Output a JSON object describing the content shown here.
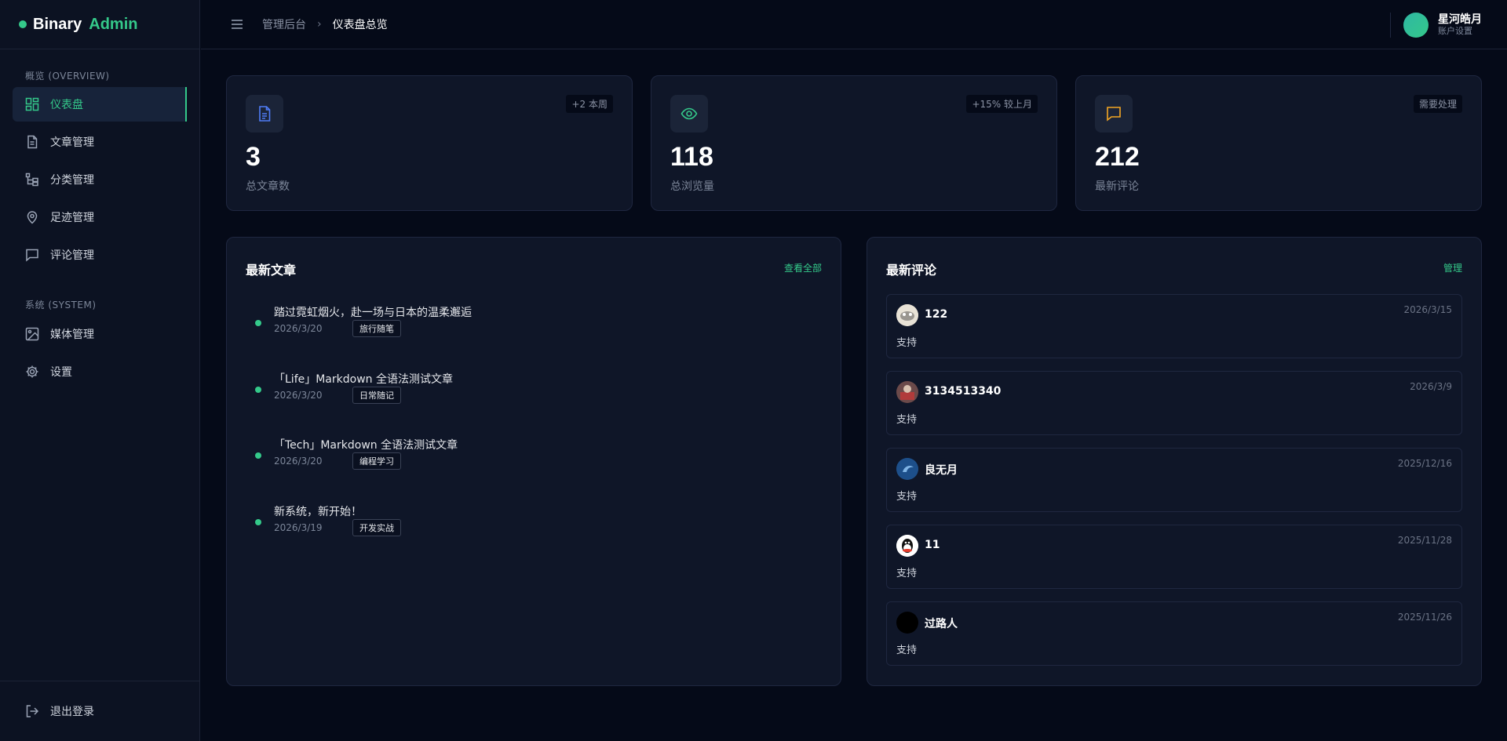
{
  "brand": {
    "name": "Binary",
    "accent": "Admin"
  },
  "sidebar": {
    "overview_label": "概览 (OVERVIEW)",
    "system_label": "系统 (SYSTEM)",
    "items": [
      {
        "label": "仪表盘",
        "icon": "dashboard-icon",
        "active": true
      },
      {
        "label": "文章管理",
        "icon": "document-icon"
      },
      {
        "label": "分类管理",
        "icon": "category-tree-icon"
      },
      {
        "label": "足迹管理",
        "icon": "map-pin-icon"
      },
      {
        "label": "评论管理",
        "icon": "message-icon"
      },
      {
        "label": "媒体管理",
        "icon": "image-icon"
      },
      {
        "label": "设置",
        "icon": "gear-icon"
      }
    ],
    "logout_label": "退出登录"
  },
  "header": {
    "breadcrumb_parent": "管理后台",
    "breadcrumb_current": "仪表盘总览",
    "user_name": "星河皓月",
    "user_sub": "账户设置"
  },
  "stats": [
    {
      "value": "3",
      "label": "总文章数",
      "badge": "+2 本周",
      "icon": "document-icon",
      "color": "#4f7cf5"
    },
    {
      "value": "118",
      "label": "总浏览量",
      "badge": "+15% 较上月",
      "icon": "eye-icon",
      "color": "#34c98a"
    },
    {
      "value": "212",
      "label": "最新评论",
      "badge": "需要处理",
      "icon": "message-icon",
      "color": "#f5a623"
    }
  ],
  "articles_panel": {
    "title": "最新文章",
    "link": "查看全部",
    "items": [
      {
        "title": "踏过霓虹烟火，赴一场与日本的温柔邂逅",
        "date": "2026/3/20",
        "tag": "旅行随笔"
      },
      {
        "title": "「Life」Markdown 全语法测试文章",
        "date": "2026/3/20",
        "tag": "日常随记"
      },
      {
        "title": "「Tech」Markdown 全语法测试文章",
        "date": "2026/3/20",
        "tag": "编程学习"
      },
      {
        "title": "新系统，新开始！",
        "date": "2026/3/19",
        "tag": "开发实战"
      }
    ]
  },
  "comments_panel": {
    "title": "最新评论",
    "link": "管理",
    "items": [
      {
        "name": "122",
        "date": "2026/3/15",
        "text": "支持"
      },
      {
        "name": "3134513340",
        "date": "2026/3/9",
        "text": "支持"
      },
      {
        "name": "良无月",
        "date": "2025/12/16",
        "text": "支持"
      },
      {
        "name": "11",
        "date": "2025/11/28",
        "text": "支持"
      },
      {
        "name": "过路人",
        "date": "2025/11/26",
        "text": "支持"
      }
    ]
  },
  "colors": {
    "accent": "#34c98a",
    "bg": "#050a18",
    "panel": "#0f1628"
  }
}
